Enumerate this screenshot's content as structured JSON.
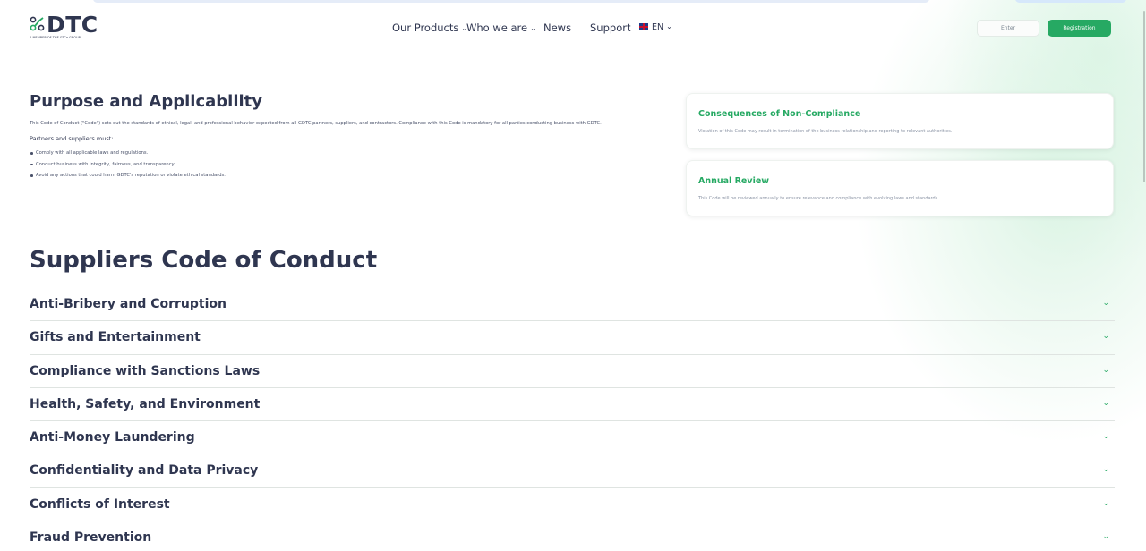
{
  "header": {
    "logo_text": "DTC",
    "logo_subtext": "A MEMBER OF THE GTCa GROUP",
    "nav": [
      {
        "label": "Our Products",
        "has_dropdown": true
      },
      {
        "label": "Who we are",
        "has_dropdown": true
      },
      {
        "label": "News",
        "has_dropdown": false
      },
      {
        "label": "Support",
        "has_dropdown": false
      },
      {
        "label": "EN",
        "has_dropdown": true
      }
    ],
    "enter_label": "Enter",
    "register_label": "Registration"
  },
  "purpose": {
    "title": "Purpose and Applicability",
    "intro": "This Code of Conduct (\"Code\") sets out the standards of ethical, legal, and professional behavior expected from all GDTC partners, suppliers, and contractors. Compliance with this Code is mandatory for all parties conducting business with GDTC.",
    "must_label": "Partners and suppliers must:",
    "items": [
      "Comply with all applicable laws and regulations.",
      "Conduct business with integrity, fairness, and transparency.",
      "Avoid any actions that could harm GDTC's reputation or violate ethical standards."
    ]
  },
  "cards": [
    {
      "title": "Consequences of Non-Compliance",
      "text": "Violation of this Code may result in termination of the business relationship and reporting to relevant authorities."
    },
    {
      "title": "Annual Review",
      "text": "This Code will be reviewed annually to ensure relevance and compliance with evolving laws and standards."
    }
  ],
  "code_section": {
    "title": "Suppliers Code of Conduct",
    "items": [
      "Anti-Bribery and Corruption",
      "Gifts and Entertainment",
      "Compliance with Sanctions Laws",
      "Health, Safety, and Environment",
      "Anti-Money Laundering",
      "Confidentiality and Data Privacy",
      "Conflicts of Interest",
      "Fraud Prevention"
    ]
  },
  "colors": {
    "accent": "#26a963",
    "text": "#2f3650",
    "muted": "#8a93a4"
  },
  "icons": {
    "dropdown": "chevron-down-icon",
    "accordion": "chevron-down-icon",
    "language": "uk-flag-icon",
    "logo": "dtc-logo-icon"
  }
}
